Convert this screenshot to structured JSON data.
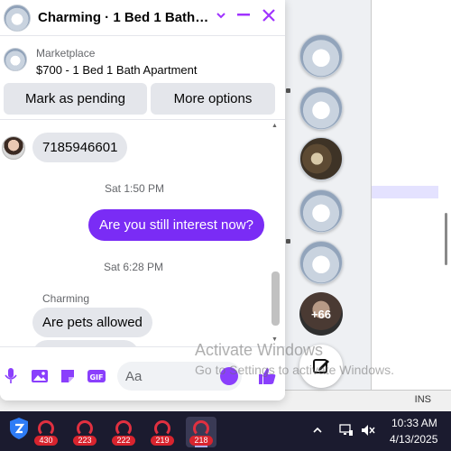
{
  "chat": {
    "title": "Charming · 1 Bed 1 Bath A...",
    "listing": {
      "source": "Marketplace",
      "name": "$700 - 1 Bed 1 Bath Apartment"
    },
    "actions": {
      "pending_label": "Mark as pending",
      "more_label": "More options"
    },
    "messages": {
      "phone": "7185946601",
      "stamp_1": "Sat 1:50 PM",
      "sent_1": "Are you still interest now?",
      "stamp_2": "Sat 6:28 PM",
      "sender": "Charming",
      "received_1": "Are pets allowed"
    },
    "composer": {
      "placeholder": "Aa"
    }
  },
  "chat_heads": {
    "more_count": "+66"
  },
  "watermark": {
    "line1": "Activate Windows",
    "line2": "Go to Settings to activate Windows."
  },
  "status_bar": {
    "ins": "INS"
  },
  "taskbar": {
    "apps": [
      {
        "badge": "430"
      },
      {
        "badge": "223"
      },
      {
        "badge": "222"
      },
      {
        "badge": "219"
      },
      {
        "badge": "218"
      }
    ],
    "time": "10:33 AM",
    "date": "4/13/2025"
  },
  "colors": {
    "accent": "#a033ff",
    "sent_bubble": "#7a2cf5",
    "received_bubble": "#e4e6eb",
    "taskbar": "#1b1b2f"
  }
}
